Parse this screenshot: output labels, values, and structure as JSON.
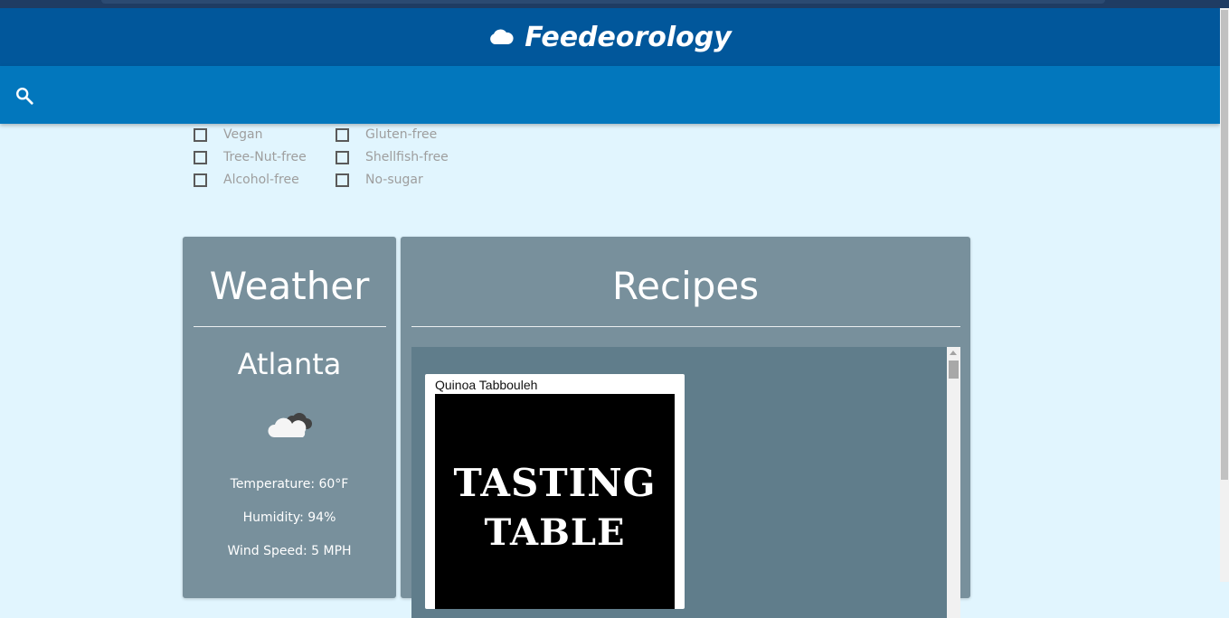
{
  "app": {
    "title": "Feedeorology",
    "brand_icon": "cloud-icon"
  },
  "search": {
    "icon": "search-icon",
    "value": ""
  },
  "filters": [
    {
      "label": "Vegan",
      "checked": false
    },
    {
      "label": "Gluten-free",
      "checked": false
    },
    {
      "label": "Tree-Nut-free",
      "checked": false
    },
    {
      "label": "Shellfish-free",
      "checked": false
    },
    {
      "label": "Alcohol-free",
      "checked": false
    },
    {
      "label": "No-sugar",
      "checked": false
    }
  ],
  "weather": {
    "heading": "Weather",
    "city": "Atlanta",
    "icon": "cloudy-icon",
    "temperature": "Temperature: 60°F",
    "humidity": "Humidity: 94%",
    "wind": "Wind Speed: 5 MPH"
  },
  "recipes": {
    "heading": "Recipes",
    "items": [
      {
        "name": "Quinoa Tabbouleh",
        "image_logo": [
          "TASTING",
          "TABLE"
        ]
      }
    ]
  },
  "colors": {
    "header": "#01579b",
    "searchbar": "#0277bd",
    "background": "#e1f5fe",
    "card": "#78909c",
    "recipe_list": "#607d8b"
  }
}
